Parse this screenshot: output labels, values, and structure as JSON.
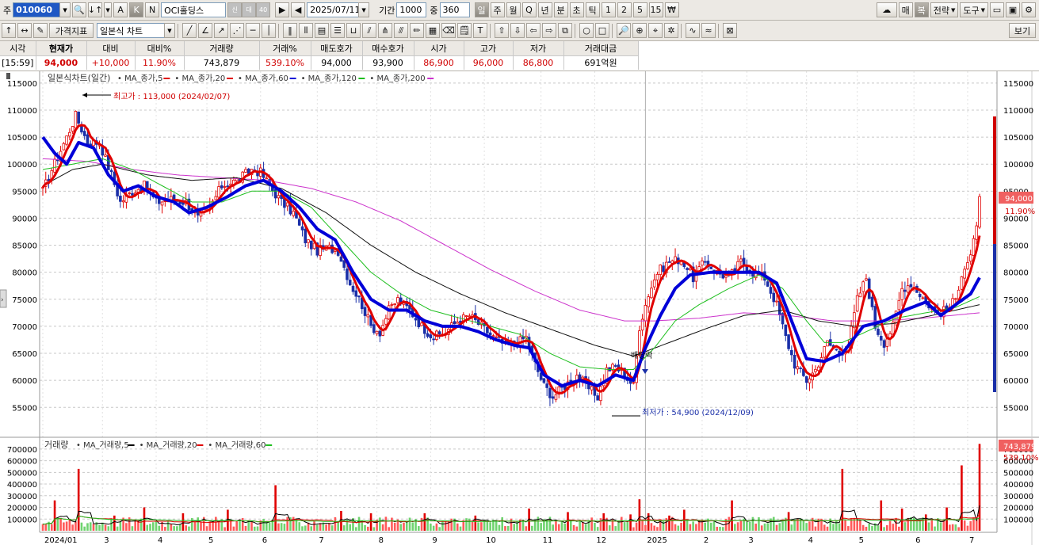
{
  "toolbar1": {
    "type_label": "주",
    "code": "010060",
    "zoom_btn_a": "A",
    "zoom_btn_k": "K",
    "zoom_btn_n": "N",
    "stock_name": "OCI홀딩스",
    "badge_1": "신",
    "badge_2": "대",
    "badge_3": "40",
    "date": "2025/07/11",
    "period_label": "기간",
    "period_value": "1000",
    "count_label": "중",
    "count_value": "360",
    "periods": [
      "일",
      "주",
      "월",
      "Q",
      "년",
      "분",
      "초",
      "틱",
      "1",
      "2",
      "5",
      "15"
    ],
    "won_symbol": "₩",
    "right_buttons": [
      "매",
      "복",
      "전략",
      "도구"
    ]
  },
  "toolbar2": {
    "price_index_label": "가격지표",
    "chart_type": "일본식 차트",
    "view_label": "보기"
  },
  "quote": {
    "headers": [
      "시각",
      "현재가",
      "대비",
      "대비%",
      "거래량",
      "거래%",
      "매도호가",
      "매수호가",
      "시가",
      "고가",
      "저가",
      "거래대금"
    ],
    "values": [
      "[15:59]",
      "94,000",
      "+10,000",
      "11.90%",
      "743,879",
      "539.10%",
      "94,000",
      "93,900",
      "86,900",
      "96,000",
      "86,800",
      "691억원"
    ]
  },
  "chart_data": [
    {
      "type": "line",
      "title": "일본식차트(일간)",
      "legend": [
        "MA_종가,5",
        "MA_종가,20",
        "MA_종가,60",
        "MA_종가,120",
        "MA_종가,200"
      ],
      "series_colors": {
        "candle": "#e00000",
        "ma5": "#e00000",
        "ma20": "#0000d8",
        "ma60": "#1fbf1f",
        "ma120": "#111111",
        "ma200": "#cc33cc"
      },
      "x_ticks": [
        "2024/01",
        "3",
        "4",
        "5",
        "6",
        "7",
        "8",
        "9",
        "10",
        "11",
        "12",
        "2025",
        "2",
        "3",
        "4",
        "5",
        "6",
        "7"
      ],
      "y_ticks": [
        115000,
        110000,
        105000,
        100000,
        95000,
        90000,
        85000,
        80000,
        75000,
        70000,
        65000,
        60000,
        55000
      ],
      "ylim": [
        50500,
        116000
      ],
      "high_label": "최고가 : 113,000 (2024/02/07)",
      "low_label": "최저가 : 54,900 (2024/12/09)",
      "dividend_label": "배당락",
      "current_price_tag": "94,000",
      "current_pct_tag": "11.90%",
      "anchors": {
        "close": [
          [
            0,
            95000
          ],
          [
            3,
            99000
          ],
          [
            8,
            105000
          ],
          [
            11,
            109000
          ],
          [
            15,
            104000
          ],
          [
            19,
            104000
          ],
          [
            23,
            98000
          ],
          [
            26,
            93000
          ],
          [
            30,
            95000
          ],
          [
            34,
            96000
          ],
          [
            38,
            93000
          ],
          [
            43,
            93500
          ],
          [
            48,
            93000
          ],
          [
            52,
            90000
          ],
          [
            56,
            92000
          ],
          [
            60,
            96000
          ],
          [
            65,
            97000
          ],
          [
            70,
            99000
          ],
          [
            73,
            98500
          ],
          [
            76,
            96000
          ],
          [
            80,
            93000
          ],
          [
            84,
            91000
          ],
          [
            88,
            86000
          ],
          [
            92,
            84000
          ],
          [
            96,
            84500
          ],
          [
            99,
            84000
          ],
          [
            103,
            78000
          ],
          [
            107,
            74000
          ],
          [
            110,
            70000
          ],
          [
            113,
            69000
          ],
          [
            116,
            73000
          ],
          [
            119,
            75000
          ],
          [
            123,
            73000
          ],
          [
            127,
            70000
          ],
          [
            131,
            68000
          ],
          [
            135,
            69000
          ],
          [
            139,
            71000
          ],
          [
            143,
            72000
          ],
          [
            147,
            70000
          ],
          [
            151,
            68000
          ],
          [
            155,
            66500
          ],
          [
            159,
            67000
          ],
          [
            162,
            68000
          ],
          [
            165,
            63000
          ],
          [
            168,
            59000
          ],
          [
            171,
            57000
          ],
          [
            175,
            59000
          ],
          [
            179,
            61000
          ],
          [
            183,
            58500
          ],
          [
            186,
            57000
          ],
          [
            189,
            62000
          ],
          [
            192,
            62500
          ],
          [
            195,
            61000
          ],
          [
            198,
            59000
          ],
          [
            200,
            70000
          ],
          [
            203,
            76000
          ],
          [
            206,
            80000
          ],
          [
            210,
            82000
          ],
          [
            214,
            82500
          ],
          [
            218,
            79000
          ],
          [
            222,
            82000
          ],
          [
            226,
            80000
          ],
          [
            230,
            79000
          ],
          [
            234,
            82000
          ],
          [
            238,
            80000
          ],
          [
            242,
            79000
          ],
          [
            246,
            74000
          ],
          [
            249,
            68000
          ],
          [
            252,
            63000
          ],
          [
            256,
            60000
          ],
          [
            259,
            62000
          ],
          [
            263,
            67000
          ],
          [
            267,
            65000
          ],
          [
            270,
            66500
          ],
          [
            273,
            75000
          ],
          [
            276,
            79000
          ],
          [
            279,
            70000
          ],
          [
            282,
            67000
          ],
          [
            285,
            70000
          ],
          [
            288,
            77000
          ],
          [
            291,
            78000
          ],
          [
            294,
            76000
          ],
          [
            297,
            74000
          ],
          [
            300,
            72500
          ],
          [
            303,
            73000
          ],
          [
            306,
            75000
          ],
          [
            308,
            80000
          ],
          [
            311,
            83000
          ],
          [
            313,
            88000
          ],
          [
            314,
            94000
          ]
        ],
        "ma20": [
          [
            0,
            105000
          ],
          [
            4,
            102000
          ],
          [
            8,
            100000
          ],
          [
            12,
            104000
          ],
          [
            17,
            103000
          ],
          [
            22,
            98000
          ],
          [
            27,
            95000
          ],
          [
            32,
            96000
          ],
          [
            38,
            94000
          ],
          [
            44,
            93000
          ],
          [
            49,
            91000
          ],
          [
            55,
            92000
          ],
          [
            62,
            94000
          ],
          [
            68,
            96000
          ],
          [
            74,
            97000
          ],
          [
            80,
            95000
          ],
          [
            86,
            92000
          ],
          [
            92,
            88000
          ],
          [
            98,
            86000
          ],
          [
            104,
            80000
          ],
          [
            110,
            75000
          ],
          [
            116,
            73000
          ],
          [
            122,
            73000
          ],
          [
            128,
            71000
          ],
          [
            134,
            70000
          ],
          [
            140,
            70000
          ],
          [
            146,
            69000
          ],
          [
            152,
            67500
          ],
          [
            158,
            66500
          ],
          [
            163,
            66000
          ],
          [
            168,
            61000
          ],
          [
            174,
            59000
          ],
          [
            180,
            60000
          ],
          [
            186,
            59000
          ],
          [
            192,
            61000
          ],
          [
            198,
            60000
          ],
          [
            202,
            66000
          ],
          [
            207,
            72000
          ],
          [
            212,
            77000
          ],
          [
            217,
            79500
          ],
          [
            224,
            80000
          ],
          [
            232,
            80000
          ],
          [
            240,
            80000
          ],
          [
            246,
            78000
          ],
          [
            251,
            71000
          ],
          [
            256,
            64000
          ],
          [
            262,
            63500
          ],
          [
            268,
            65000
          ],
          [
            275,
            70000
          ],
          [
            282,
            71000
          ],
          [
            289,
            73000
          ],
          [
            296,
            74500
          ],
          [
            301,
            72000
          ],
          [
            306,
            74000
          ],
          [
            311,
            76000
          ],
          [
            314,
            79000
          ]
        ],
        "ma60": [
          [
            0,
            99000
          ],
          [
            10,
            100000
          ],
          [
            20,
            101000
          ],
          [
            30,
            99000
          ],
          [
            40,
            96000
          ],
          [
            50,
            93000
          ],
          [
            60,
            93000
          ],
          [
            70,
            95000
          ],
          [
            80,
            95000
          ],
          [
            90,
            92000
          ],
          [
            100,
            86000
          ],
          [
            110,
            80000
          ],
          [
            120,
            76000
          ],
          [
            130,
            73000
          ],
          [
            140,
            71500
          ],
          [
            150,
            70000
          ],
          [
            160,
            68500
          ],
          [
            170,
            65000
          ],
          [
            180,
            62500
          ],
          [
            190,
            62000
          ],
          [
            198,
            62000
          ],
          [
            205,
            66000
          ],
          [
            212,
            71000
          ],
          [
            220,
            74000
          ],
          [
            230,
            77000
          ],
          [
            240,
            79500
          ],
          [
            248,
            77000
          ],
          [
            256,
            71000
          ],
          [
            262,
            67000
          ],
          [
            268,
            67000
          ],
          [
            276,
            69000
          ],
          [
            286,
            71500
          ],
          [
            296,
            72500
          ],
          [
            306,
            73500
          ],
          [
            314,
            75500
          ]
        ],
        "ma120": [
          [
            0,
            96000
          ],
          [
            10,
            99000
          ],
          [
            20,
            100000
          ],
          [
            35,
            98000
          ],
          [
            50,
            97000
          ],
          [
            65,
            97500
          ],
          [
            80,
            95500
          ],
          [
            95,
            91000
          ],
          [
            110,
            85000
          ],
          [
            125,
            80000
          ],
          [
            140,
            76000
          ],
          [
            155,
            72500
          ],
          [
            170,
            69500
          ],
          [
            185,
            66500
          ],
          [
            198,
            64500
          ],
          [
            210,
            67000
          ],
          [
            222,
            69500
          ],
          [
            235,
            72000
          ],
          [
            248,
            73000
          ],
          [
            260,
            71000
          ],
          [
            272,
            70000
          ],
          [
            285,
            70500
          ],
          [
            298,
            72000
          ],
          [
            314,
            74000
          ]
        ],
        "ma200": [
          [
            0,
            101000
          ],
          [
            15,
            100500
          ],
          [
            30,
            99000
          ],
          [
            45,
            98000
          ],
          [
            60,
            97500
          ],
          [
            75,
            97000
          ],
          [
            90,
            95500
          ],
          [
            105,
            93000
          ],
          [
            120,
            89500
          ],
          [
            135,
            85000
          ],
          [
            150,
            80500
          ],
          [
            165,
            76500
          ],
          [
            180,
            73000
          ],
          [
            195,
            71000
          ],
          [
            205,
            71000
          ],
          [
            220,
            71500
          ],
          [
            235,
            72500
          ],
          [
            250,
            72000
          ],
          [
            265,
            71000
          ],
          [
            280,
            71000
          ],
          [
            295,
            71500
          ],
          [
            314,
            72500
          ]
        ]
      }
    },
    {
      "type": "bar",
      "title": "거래량",
      "legend": [
        "MA_거래량,5",
        "MA_거래량,20",
        "MA_거래량,60"
      ],
      "y_ticks": [
        700000,
        600000,
        500000,
        400000,
        300000,
        200000,
        100000
      ],
      "ylim": [
        0,
        760000
      ],
      "volume_tag": "743,879",
      "volume_pct_tag": "539.10%",
      "spikes": [
        [
          4,
          260000
        ],
        [
          12,
          530000
        ],
        [
          24,
          130000
        ],
        [
          34,
          200000
        ],
        [
          47,
          150000
        ],
        [
          62,
          180000
        ],
        [
          78,
          390000
        ],
        [
          100,
          170000
        ],
        [
          110,
          150000
        ],
        [
          128,
          150000
        ],
        [
          145,
          130000
        ],
        [
          163,
          190000
        ],
        [
          176,
          160000
        ],
        [
          188,
          150000
        ],
        [
          197,
          140000
        ],
        [
          200,
          270000
        ],
        [
          203,
          150000
        ],
        [
          210,
          130000
        ],
        [
          215,
          180000
        ],
        [
          231,
          260000
        ],
        [
          250,
          160000
        ],
        [
          268,
          530000
        ],
        [
          281,
          260000
        ],
        [
          288,
          190000
        ],
        [
          296,
          140000
        ],
        [
          303,
          200000
        ],
        [
          308,
          560000
        ],
        [
          314,
          743879
        ]
      ]
    }
  ]
}
